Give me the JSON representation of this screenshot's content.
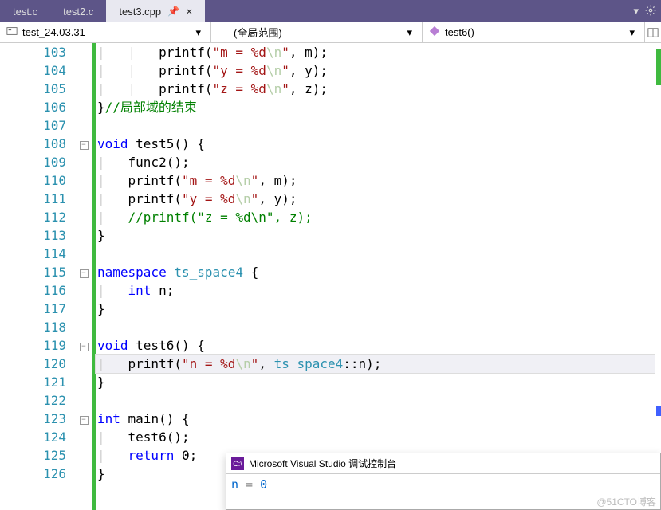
{
  "tabs": [
    {
      "label": "test.c",
      "active": false
    },
    {
      "label": "test2.c",
      "active": false
    },
    {
      "label": "test3.cpp",
      "active": true
    }
  ],
  "nav": {
    "project": "test_24.03.31",
    "scope": "(全局范围)",
    "member": "test6()"
  },
  "lines": [
    {
      "n": "103",
      "fold": "",
      "html": "        printf(<span class='str'>\"m = %d</span><span class='esc'>\\n</span><span class='str'>\"</span>, m);"
    },
    {
      "n": "104",
      "fold": "",
      "html": "        printf(<span class='str'>\"y = %d</span><span class='esc'>\\n</span><span class='str'>\"</span>, y);"
    },
    {
      "n": "105",
      "fold": "",
      "html": "        printf(<span class='str'>\"z = %d</span><span class='esc'>\\n</span><span class='str'>\"</span>, z);"
    },
    {
      "n": "106",
      "fold": "",
      "html": "}<span class='cmt'>//局部域的结束</span>"
    },
    {
      "n": "107",
      "fold": "",
      "html": ""
    },
    {
      "n": "108",
      "fold": "-",
      "html": "<span class='kw'>void</span> test5() {"
    },
    {
      "n": "109",
      "fold": "",
      "html": "    func2();"
    },
    {
      "n": "110",
      "fold": "",
      "html": "    printf(<span class='str'>\"m = %d</span><span class='esc'>\\n</span><span class='str'>\"</span>, m);"
    },
    {
      "n": "111",
      "fold": "",
      "html": "    printf(<span class='str'>\"y = %d</span><span class='esc'>\\n</span><span class='str'>\"</span>, y);"
    },
    {
      "n": "112",
      "fold": "",
      "html": "    <span class='cmt'>//printf(\"z = %d\\n\", z);</span>"
    },
    {
      "n": "113",
      "fold": "",
      "html": "}"
    },
    {
      "n": "114",
      "fold": "",
      "html": ""
    },
    {
      "n": "115",
      "fold": "-",
      "html": "<span class='kw'>namespace</span> <span class='ns'>ts_space4</span> {"
    },
    {
      "n": "116",
      "fold": "",
      "html": "    <span class='kw'>int</span> n;"
    },
    {
      "n": "117",
      "fold": "",
      "html": "}"
    },
    {
      "n": "118",
      "fold": "",
      "html": ""
    },
    {
      "n": "119",
      "fold": "-",
      "html": "<span class='kw'>void</span> test6() {"
    },
    {
      "n": "120",
      "fold": "",
      "cur": true,
      "html": "    printf(<span class='str'>\"n = %d</span><span class='esc'>\\n</span><span class='str'>\"</span>, <span class='ns'>ts_space4</span>::n);"
    },
    {
      "n": "121",
      "fold": "",
      "html": "}"
    },
    {
      "n": "122",
      "fold": "",
      "html": ""
    },
    {
      "n": "123",
      "fold": "-",
      "html": "<span class='kw'>int</span> main() {"
    },
    {
      "n": "124",
      "fold": "",
      "html": "    test6();"
    },
    {
      "n": "125",
      "fold": "",
      "html": "    <span class='kw'>return</span> 0;"
    },
    {
      "n": "126",
      "fold": "",
      "html": "}"
    }
  ],
  "console": {
    "title": "Microsoft Visual Studio 调试控制台",
    "output_label": "n",
    "output_sep": " = ",
    "output_val": "0"
  },
  "watermark": "@51CTO博客"
}
